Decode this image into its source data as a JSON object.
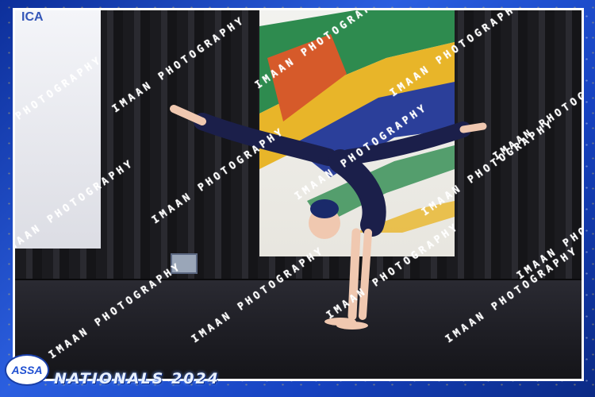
{
  "photo": {
    "left_screen_text": "ICA",
    "subject": "gymnast"
  },
  "watermark": {
    "text": "IMAAN PHOTOGRAPHY"
  },
  "footer": {
    "logo_text": "ASSA",
    "event_title": "NATIONALS 2024"
  },
  "colors": {
    "frame_blue": "#1a3fa8",
    "title_color": "#e9f1ff",
    "leotard": "#1b1f4a"
  }
}
